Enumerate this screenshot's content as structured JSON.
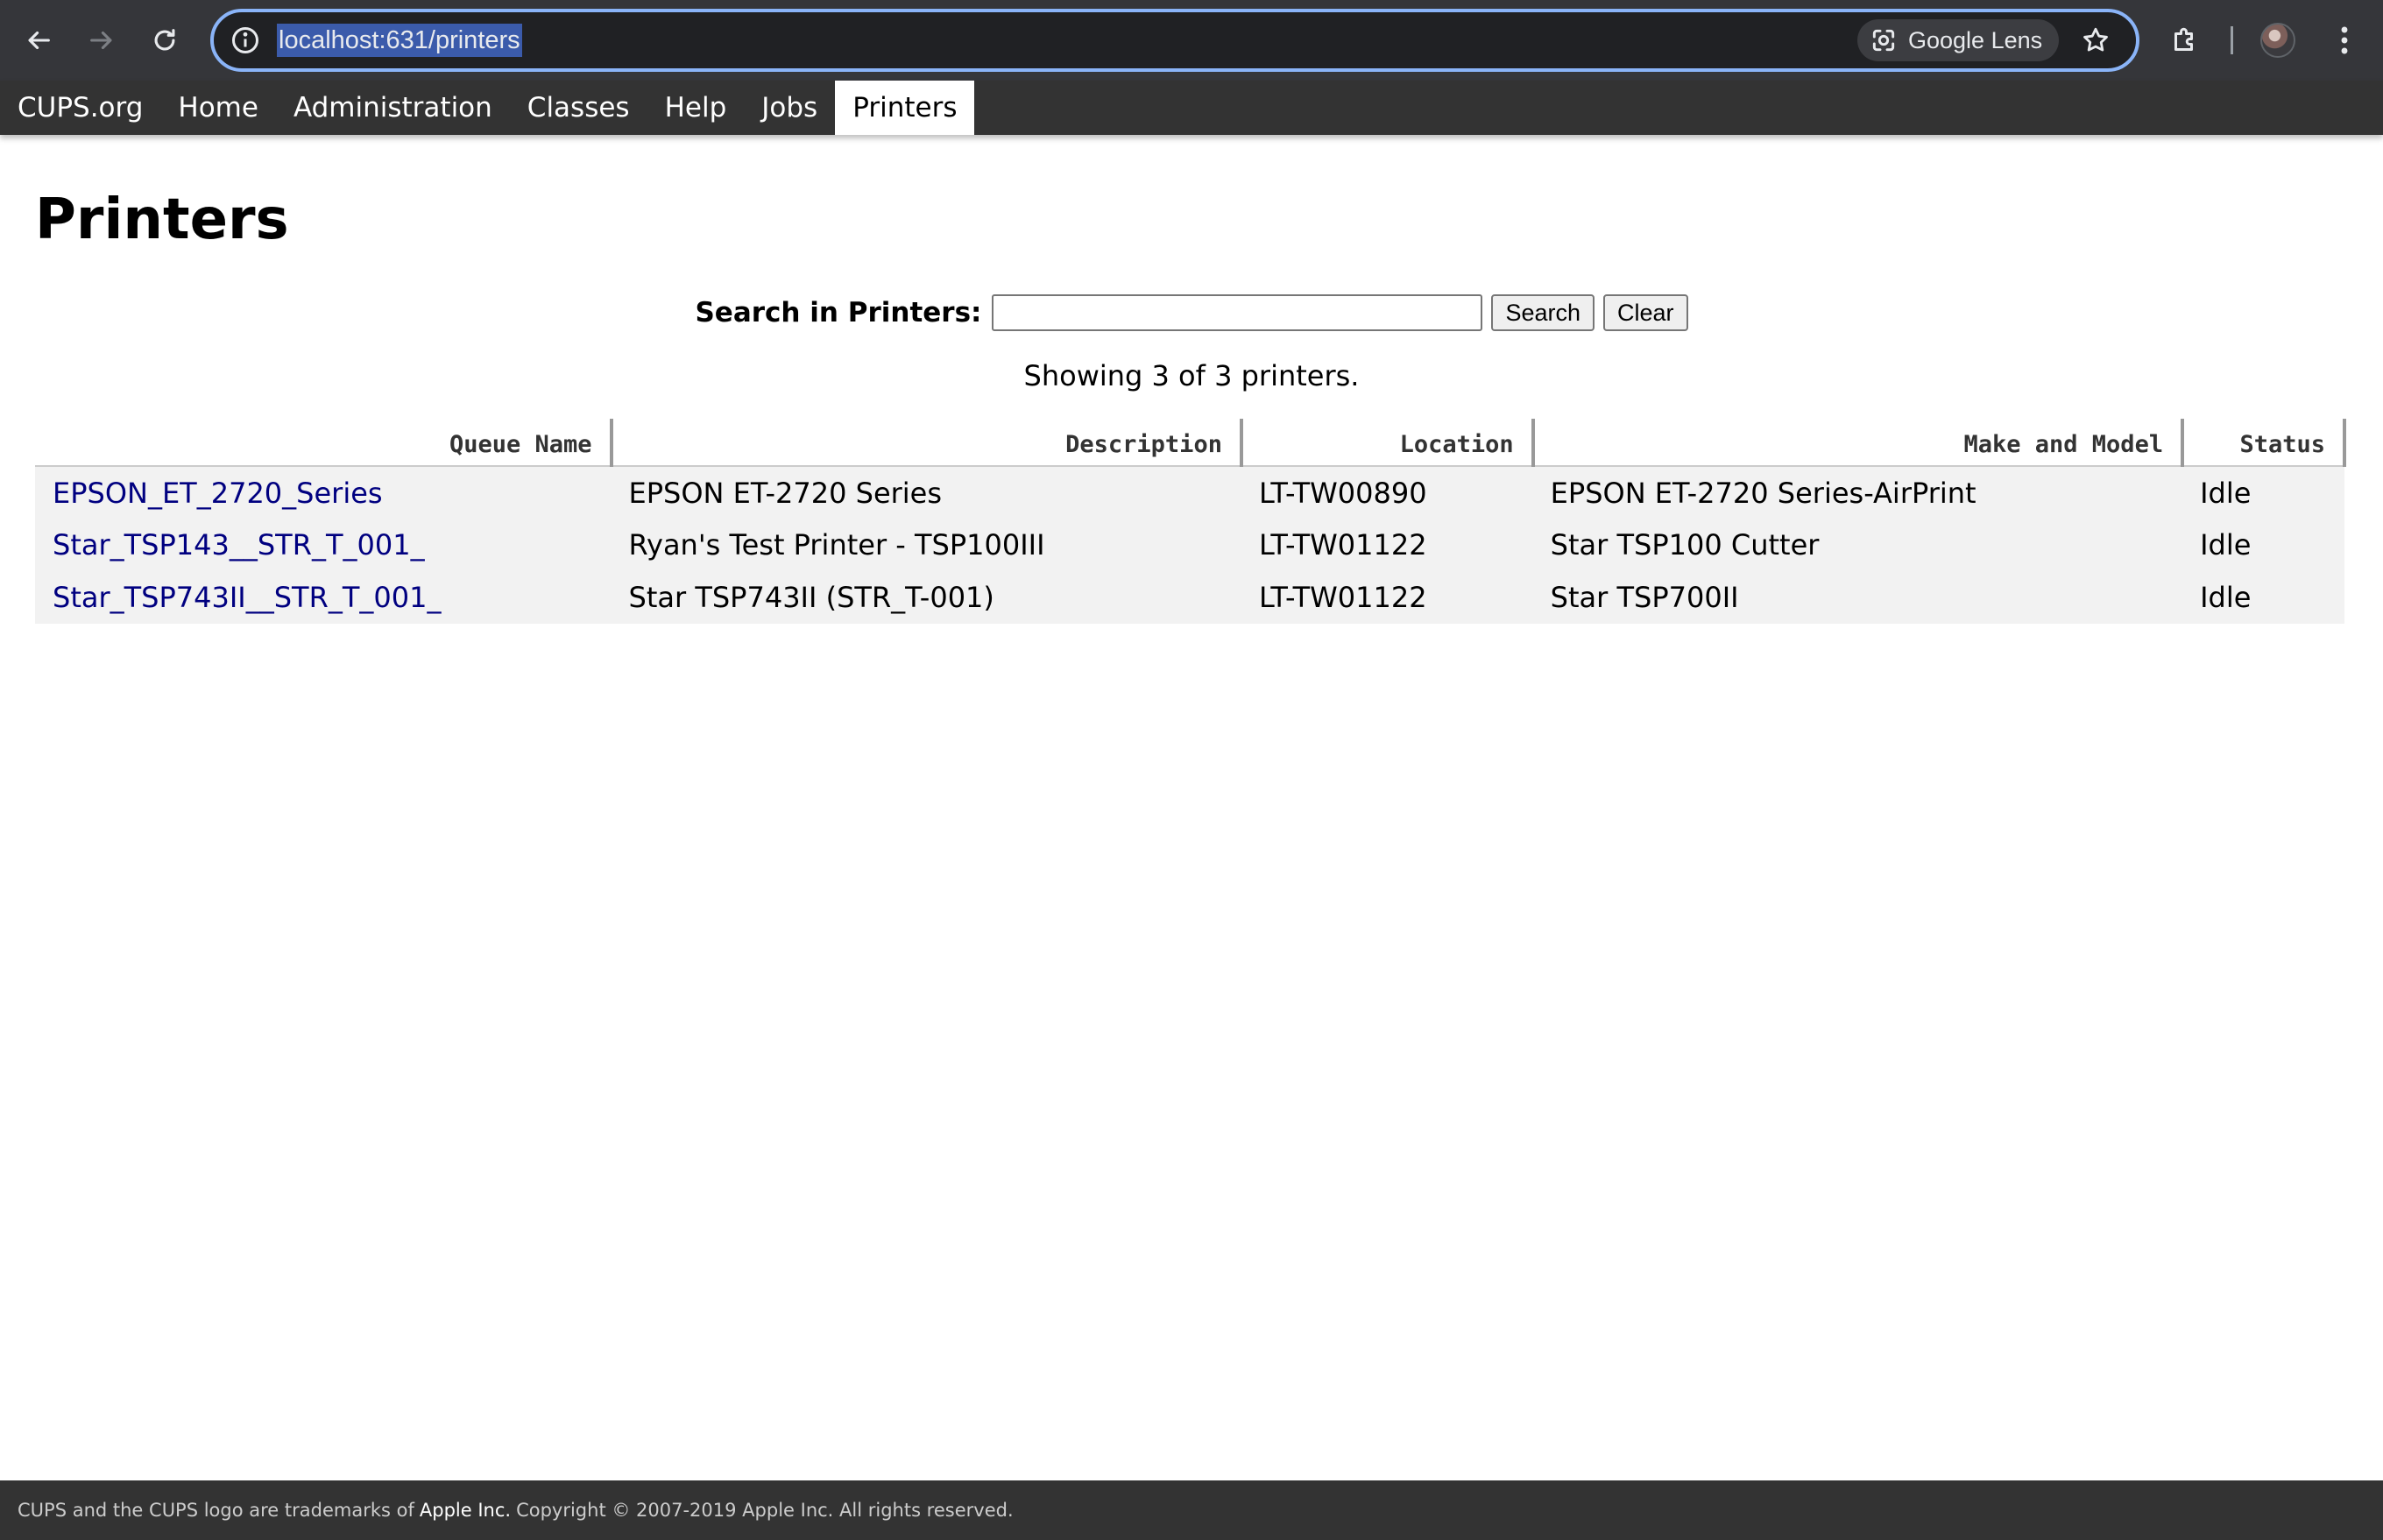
{
  "browser": {
    "url": "localhost:631/printers",
    "lens_label": "Google Lens",
    "icons": {
      "back": "arrow-left-icon",
      "forward": "arrow-right-icon",
      "reload": "reload-icon",
      "site_info": "info-icon",
      "lens": "camera-lens-icon",
      "bookmark": "star-icon",
      "extensions": "puzzle-icon",
      "menu": "kebab-menu-icon"
    }
  },
  "nav": {
    "items": [
      {
        "label": "CUPS.org",
        "active": false
      },
      {
        "label": "Home",
        "active": false
      },
      {
        "label": "Administration",
        "active": false
      },
      {
        "label": "Classes",
        "active": false
      },
      {
        "label": "Help",
        "active": false
      },
      {
        "label": "Jobs",
        "active": false
      },
      {
        "label": "Printers",
        "active": true
      }
    ]
  },
  "page": {
    "title": "Printers",
    "search_label": "Search in Printers:",
    "search_value": "",
    "search_button": "Search",
    "clear_button": "Clear",
    "showing": "Showing 3 of 3 printers."
  },
  "table": {
    "headers": [
      "Queue Name",
      "Description",
      "Location",
      "Make and Model",
      "Status"
    ],
    "rows": [
      {
        "queue": "EPSON_ET_2720_Series",
        "description": "EPSON ET-2720 Series",
        "location": "LT-TW00890",
        "model": "EPSON ET-2720 Series-AirPrint",
        "status": "Idle"
      },
      {
        "queue": "Star_TSP143__STR_T_001_",
        "description": "Ryan's Test Printer - TSP100III",
        "location": "LT-TW01122",
        "model": "Star TSP100 Cutter",
        "status": "Idle"
      },
      {
        "queue": "Star_TSP743II__STR_T_001_",
        "description": "Star TSP743II (STR_T-001)",
        "location": "LT-TW01122",
        "model": "Star TSP700II",
        "status": "Idle"
      }
    ]
  },
  "footer": {
    "prefix": "CUPS and the CUPS logo are trademarks of",
    "company": "Apple Inc.",
    "suffix": "Copyright © 2007-2019 Apple Inc. All rights reserved."
  },
  "colors": {
    "chrome_bg": "#35363a",
    "omnibox_focus": "#8ab4f8",
    "cups_nav_bg": "#333333",
    "link": "#000080",
    "row_bg": "#f2f2f2"
  }
}
